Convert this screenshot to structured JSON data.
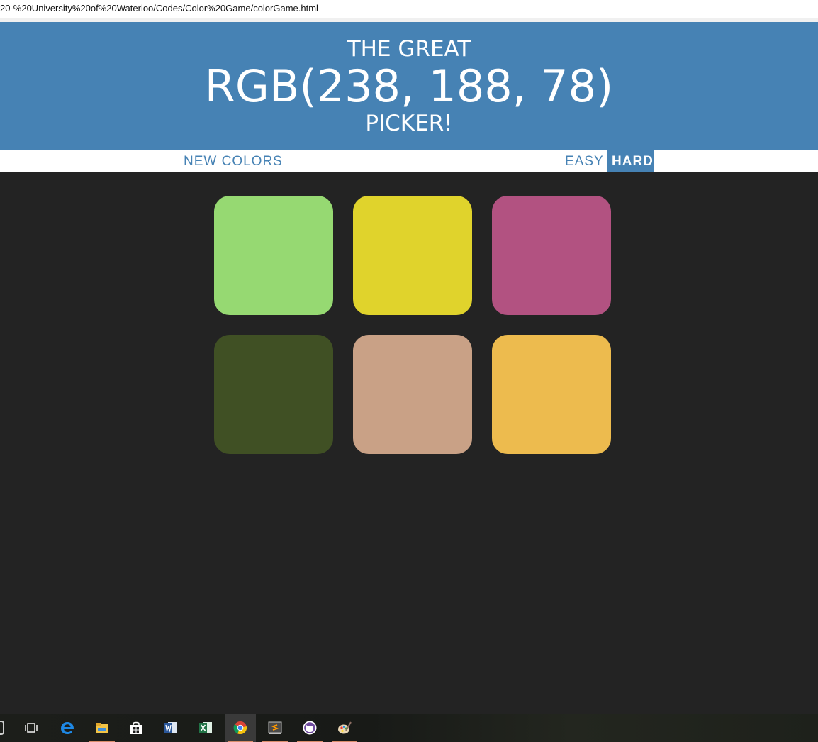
{
  "browser": {
    "url_text": "20-%20University%20of%20Waterloo/Codes/Color%20Game/colorGame.html"
  },
  "header": {
    "line1": "THE GREAT",
    "rgb_display": "RGB(238, 188, 78)",
    "line3": "PICKER!",
    "background": "#4682b4"
  },
  "controls": {
    "new_colors": "NEW COLORS",
    "easy": "EASY",
    "hard": "HARD",
    "selected_mode": "HARD"
  },
  "squares": [
    {
      "color": "#96d972"
    },
    {
      "color": "#e0d32c"
    },
    {
      "color": "#b25281"
    },
    {
      "color": "#405024"
    },
    {
      "color": "#c9a186"
    },
    {
      "color": "#edbb4e"
    }
  ],
  "taskbar": {
    "icons": [
      "task-view-icon",
      "edge-icon",
      "file-explorer-icon",
      "store-icon",
      "word-icon",
      "excel-icon",
      "chrome-icon",
      "sublime-text-icon",
      "github-desktop-icon",
      "paint-icon"
    ],
    "active_icon": "chrome-icon"
  }
}
